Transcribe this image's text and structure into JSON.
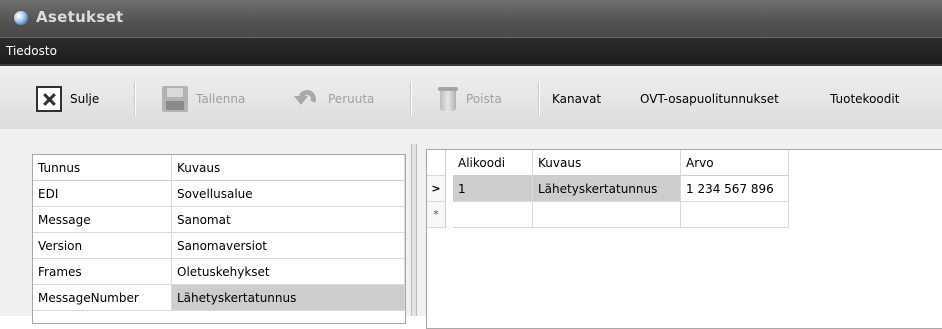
{
  "window": {
    "title": "Asetukset"
  },
  "menu": {
    "items": [
      "Tiedosto"
    ]
  },
  "toolbar": {
    "close_label": "Sulje",
    "save_label": "Tallenna",
    "undo_label": "Peruuta",
    "delete_label": "Poista",
    "channels_label": "Kanavat",
    "ovt_label": "OVT-osapuolitunnukset",
    "product_codes_label": "Tuotekoodit"
  },
  "left_grid": {
    "columns": [
      "Tunnus",
      "Kuvaus"
    ],
    "rows": [
      [
        "EDI",
        "Sovellusalue"
      ],
      [
        "Message",
        "Sanomat"
      ],
      [
        "Version",
        "Sanomaversiot"
      ],
      [
        "Frames",
        "Oletuskehykset"
      ],
      [
        "MessageNumber",
        "Lähetyskertatunnus"
      ]
    ],
    "selected_row": 4
  },
  "right_grid": {
    "columns": [
      "Alikoodi",
      "Kuvaus",
      "Arvo"
    ],
    "rows": [
      [
        "1",
        "Lähetyskertatunnus",
        "1 234 567 896"
      ]
    ],
    "current_row_marker": ">",
    "new_row_marker": "*"
  }
}
